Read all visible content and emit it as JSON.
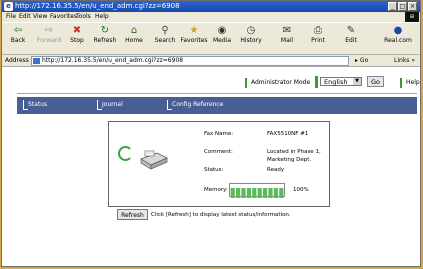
{
  "window": {
    "title": "http://172.16.35.5/en/u_end_adm.cgi?zz=6908"
  },
  "menu": [
    "File",
    "Edit",
    "View",
    "Favorites",
    "Tools",
    "Help"
  ],
  "toolbar": [
    "Back",
    "Forward",
    "Stop",
    "Refresh",
    "Home",
    "Search",
    "Favorites",
    "Media",
    "History",
    "Mail",
    "Print",
    "Edit",
    "Real.com"
  ],
  "address": {
    "label": "Address",
    "url": "http://172.16.35.5/en/u_end_adm.cgi?zz=6908",
    "go": "Go",
    "links": "Links"
  },
  "page": {
    "mode": "Administrator Mode",
    "language": "English",
    "go": "Go",
    "help": "Help",
    "tabs": [
      "Status",
      "Journal",
      "Config Reference"
    ],
    "status": {
      "fax_name_label": "Fax Name:",
      "fax_name": "FAX5510NF #1",
      "comment_label": "Comment:",
      "comment": "Located in Phase 1, Marketing Dept.",
      "status_label": "Status:",
      "status": "Ready",
      "memory_label": "Memory:",
      "memory_percent": "100%",
      "memory_fraction": 1.0
    },
    "refresh_button": "Refresh",
    "refresh_note": "Click [Refresh] to display latest status/information."
  },
  "colors": {
    "nav": "#4a5e96",
    "accent": "#3a9a3a",
    "meter": "#5cb85c",
    "titlebar": "#1a4aa8"
  }
}
